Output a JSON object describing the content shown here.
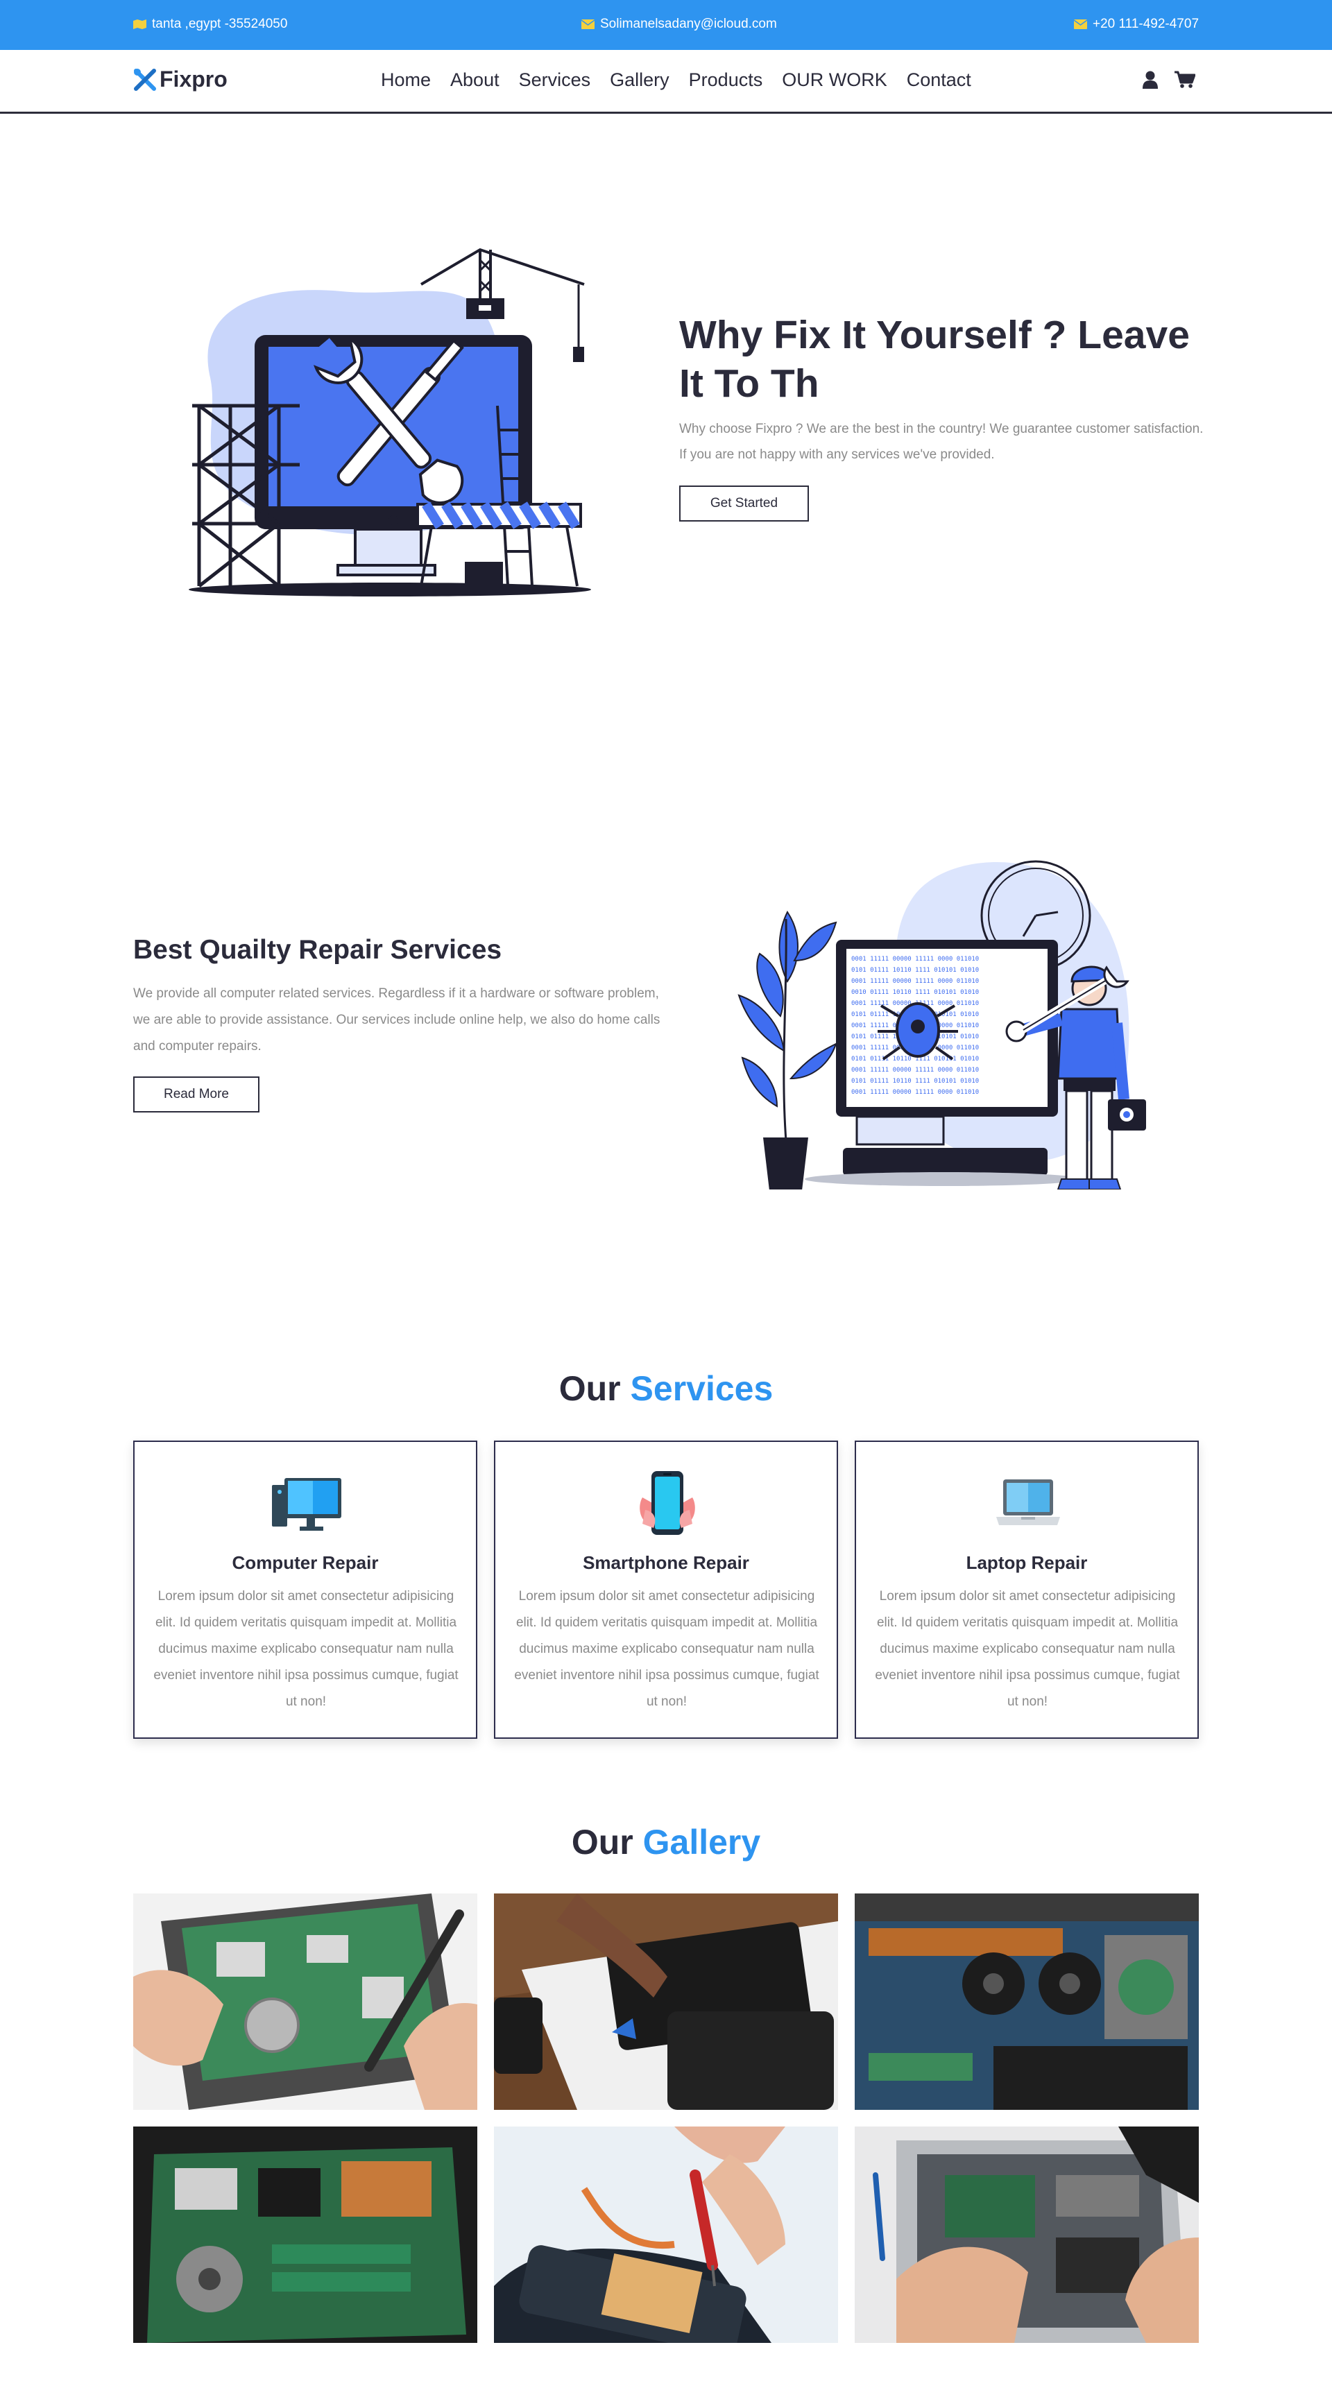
{
  "topbar": {
    "location": "tanta ,egypt -35524050",
    "email": "Solimanelsadany@icloud.com",
    "phone": "+20 111-492-4707",
    "icon_color": "#f4d03f"
  },
  "brand": {
    "name": "Fixpro",
    "accent": "#2e94f0"
  },
  "nav": {
    "items": [
      "Home",
      "About",
      "Services",
      "Gallery",
      "Products",
      "OUR WORK",
      "Contact"
    ]
  },
  "hero": {
    "title": "Why Fix It Yourself ? Leave It To Th",
    "text": "Why choose Fixpro ? We are the best in the country! We guarantee customer satisfaction. If you are not happy with any services we've provided.",
    "button": "Get Started"
  },
  "about": {
    "title": "Best Quailty Repair Services",
    "text": "We provide all computer related services. Regardless if it a hardware or software problem, we are able to provide assistance. Our services include online help, we also do home calls and computer repairs.",
    "button": "Read More"
  },
  "services": {
    "title_prefix": "Our",
    "title_accent": "Services",
    "cards": [
      {
        "title": "Computer Repair",
        "icon": "computer-icon",
        "text": "Lorem ipsum dolor sit amet consectetur adipisicing elit. Id quidem veritatis quisquam impedit at. Mollitia ducimus maxime explicabo consequatur nam nulla eveniet inventore nihil ipsa possimus cumque, fugiat ut non!"
      },
      {
        "title": "Smartphone Repair",
        "icon": "smartphone-icon",
        "text": "Lorem ipsum dolor sit amet consectetur adipisicing elit. Id quidem veritatis quisquam impedit at. Mollitia ducimus maxime explicabo consequatur nam nulla eveniet inventore nihil ipsa possimus cumque, fugiat ut non!"
      },
      {
        "title": "Laptop Repair",
        "icon": "laptop-icon",
        "text": "Lorem ipsum dolor sit amet consectetur adipisicing elit. Id quidem veritatis quisquam impedit at. Mollitia ducimus maxime explicabo consequatur nam nulla eveniet inventore nihil ipsa possimus cumque, fugiat ut non!"
      }
    ]
  },
  "gallery": {
    "title_prefix": "Our",
    "title_accent": "Gallery"
  }
}
